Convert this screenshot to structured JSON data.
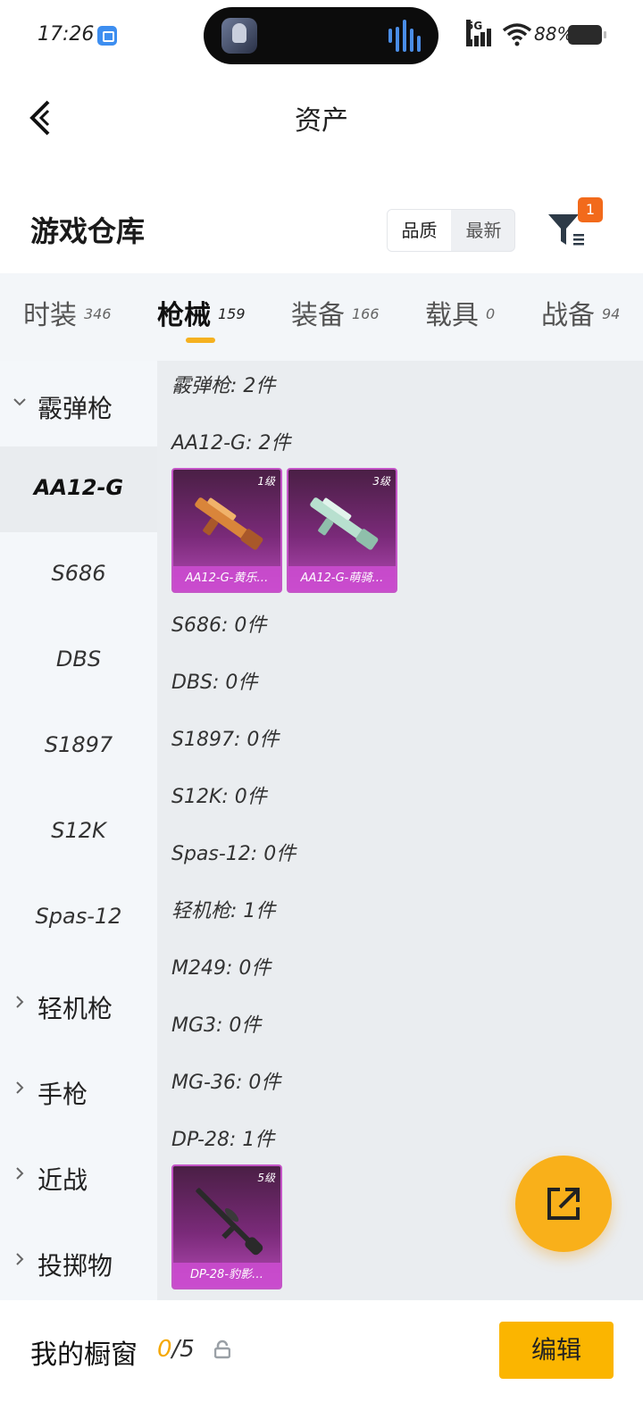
{
  "status_bar": {
    "time": "17:26",
    "network": "5G",
    "battery": "88%"
  },
  "header": {
    "title": "资产"
  },
  "warehouse": {
    "title": "游戏仓库",
    "sort_options": [
      "品质",
      "最新"
    ],
    "filter_badge": "1"
  },
  "tabs": [
    {
      "label": "时装",
      "count": "346"
    },
    {
      "label": "枪械",
      "count": "159",
      "active": true
    },
    {
      "label": "装备",
      "count": "166"
    },
    {
      "label": "载具",
      "count": "0"
    },
    {
      "label": "战备",
      "count": "94"
    }
  ],
  "sidebar": {
    "items": [
      {
        "label": "霰弹枪",
        "type": "group",
        "expanded": true
      },
      {
        "label": "AA12-G",
        "selected": true
      },
      {
        "label": "S686"
      },
      {
        "label": "DBS"
      },
      {
        "label": "S1897"
      },
      {
        "label": "S12K"
      },
      {
        "label": "Spas-12"
      },
      {
        "label": "轻机枪",
        "type": "group"
      },
      {
        "label": "手枪",
        "type": "group"
      },
      {
        "label": "近战",
        "type": "group"
      },
      {
        "label": "投掷物",
        "type": "group"
      }
    ]
  },
  "content": {
    "rows": [
      "霰弹枪: 2件",
      "AA12-G: 2件",
      "S686: 0件",
      "DBS: 0件",
      "S1897: 0件",
      "S12K: 0件",
      "Spas-12: 0件",
      "轻机枪: 1件",
      "M249: 0件",
      "MG3: 0件",
      "MG-36: 0件",
      "DP-28: 1件"
    ],
    "cards": [
      {
        "level": "1级",
        "name": "AA12-G-黄乐…",
        "weapon_color": "#d9853a"
      },
      {
        "level": "3级",
        "name": "AA12-G-萌骑…",
        "weapon_color": "#b8e0cf"
      },
      {
        "level": "5级",
        "name": "DP-28-豹影…",
        "weapon_color": "#2a2a2a"
      }
    ]
  },
  "showcase": {
    "title": "我的橱窗",
    "current": "0",
    "total": "/5",
    "edit_label": "编辑"
  },
  "colors": {
    "accent": "#f5b120",
    "card_purple": "#7a2a79",
    "badge": "#f26a1b"
  }
}
